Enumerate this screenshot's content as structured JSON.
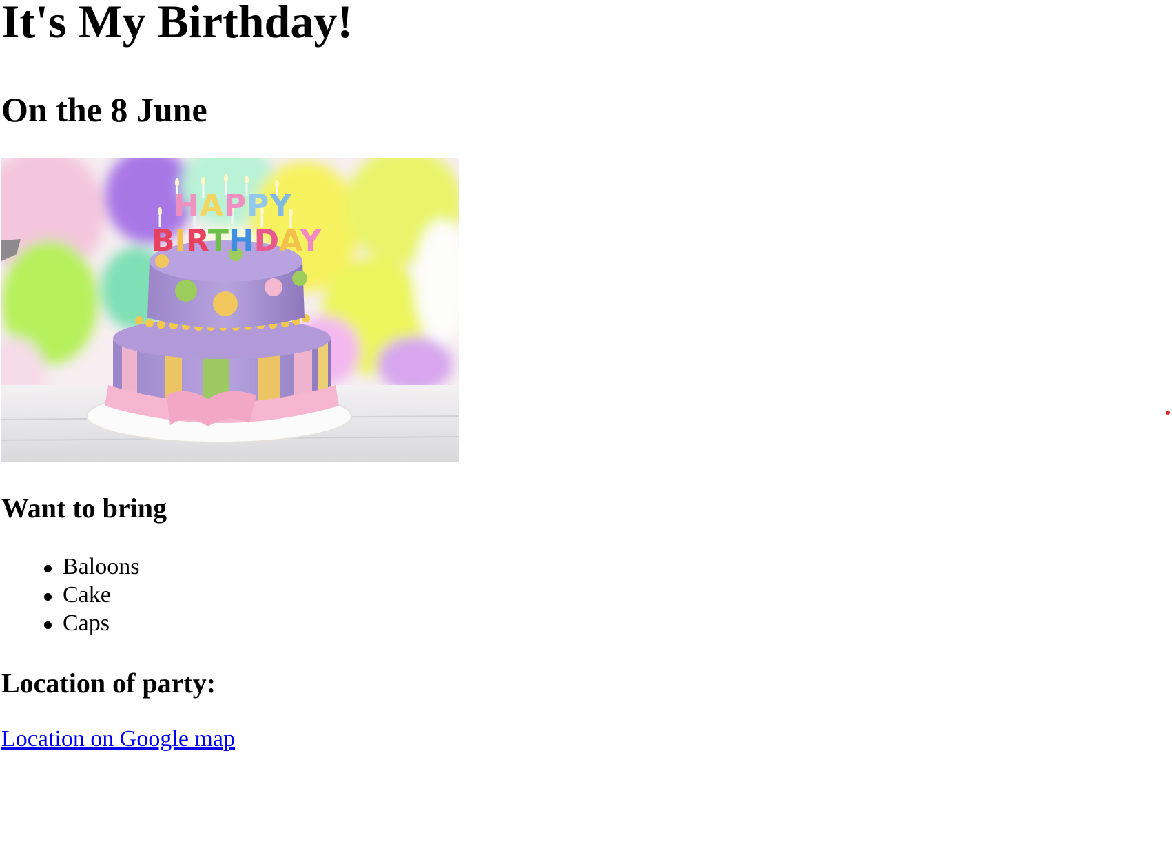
{
  "page": {
    "title": "It's My Birthday!",
    "date_heading": "On the 8 June"
  },
  "image": {
    "cake_letters_top": "HAPPY",
    "cake_letters_bottom": "BIRTHDAY"
  },
  "bring": {
    "heading": "Want to bring",
    "items": [
      "Baloons",
      "Cake",
      "Caps"
    ]
  },
  "location": {
    "heading": "Location of party:",
    "link_text": "Location on Google map"
  },
  "colors": {
    "link": "#0000ee",
    "marker": "#e0262b"
  }
}
